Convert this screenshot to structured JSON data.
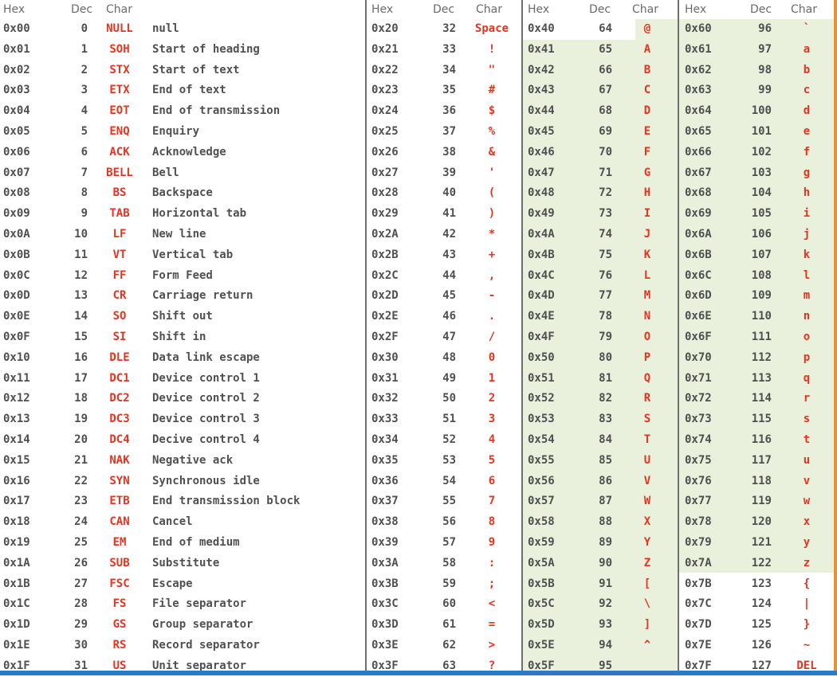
{
  "headers": {
    "g1": [
      "Hex",
      "Dec",
      "Char"
    ],
    "g2": [
      "Hex",
      "Dec",
      "Char"
    ],
    "g3": [
      "Hex",
      "Dec",
      "Char"
    ],
    "g4": [
      "Hex",
      "Dec",
      "Char"
    ]
  },
  "control_rows": [
    [
      "0x00",
      "0",
      "NULL",
      "null"
    ],
    [
      "0x01",
      "1",
      "SOH",
      "Start of heading"
    ],
    [
      "0x02",
      "2",
      "STX",
      "Start of text"
    ],
    [
      "0x03",
      "3",
      "ETX",
      "End of text"
    ],
    [
      "0x04",
      "4",
      "EOT",
      "End of transmission"
    ],
    [
      "0x05",
      "5",
      "ENQ",
      "Enquiry"
    ],
    [
      "0x06",
      "6",
      "ACK",
      "Acknowledge"
    ],
    [
      "0x07",
      "7",
      "BELL",
      "Bell"
    ],
    [
      "0x08",
      "8",
      "BS",
      "Backspace"
    ],
    [
      "0x09",
      "9",
      "TAB",
      "Horizontal tab"
    ],
    [
      "0x0A",
      "10",
      "LF",
      "New line"
    ],
    [
      "0x0B",
      "11",
      "VT",
      "Vertical tab"
    ],
    [
      "0x0C",
      "12",
      "FF",
      "Form Feed"
    ],
    [
      "0x0D",
      "13",
      "CR",
      "Carriage return"
    ],
    [
      "0x0E",
      "14",
      "SO",
      "Shift out"
    ],
    [
      "0x0F",
      "15",
      "SI",
      "Shift in"
    ],
    [
      "0x10",
      "16",
      "DLE",
      "Data link escape"
    ],
    [
      "0x11",
      "17",
      "DC1",
      "Device control 1"
    ],
    [
      "0x12",
      "18",
      "DC2",
      "Device control 2"
    ],
    [
      "0x13",
      "19",
      "DC3",
      "Device control 3"
    ],
    [
      "0x14",
      "20",
      "DC4",
      "Decive control 4"
    ],
    [
      "0x15",
      "21",
      "NAK",
      "Negative ack"
    ],
    [
      "0x16",
      "22",
      "SYN",
      "Synchronous idle"
    ],
    [
      "0x17",
      "23",
      "ETB",
      "End transmission block"
    ],
    [
      "0x18",
      "24",
      "CAN",
      "Cancel"
    ],
    [
      "0x19",
      "25",
      "EM",
      "End of medium"
    ],
    [
      "0x1A",
      "26",
      "SUB",
      "Substitute"
    ],
    [
      "0x1B",
      "27",
      "FSC",
      "Escape"
    ],
    [
      "0x1C",
      "28",
      "FS",
      "File separator"
    ],
    [
      "0x1D",
      "29",
      "GS",
      "Group separator"
    ],
    [
      "0x1E",
      "30",
      "RS",
      "Record separator"
    ],
    [
      "0x1F",
      "31",
      "US",
      "Unit separator"
    ]
  ],
  "punct_rows": [
    [
      "0x20",
      "32",
      "Space"
    ],
    [
      "0x21",
      "33",
      "!"
    ],
    [
      "0x22",
      "34",
      "\""
    ],
    [
      "0x23",
      "35",
      "#"
    ],
    [
      "0x24",
      "36",
      "$"
    ],
    [
      "0x25",
      "37",
      "%"
    ],
    [
      "0x26",
      "38",
      "&"
    ],
    [
      "0x27",
      "39",
      "'"
    ],
    [
      "0x28",
      "40",
      "("
    ],
    [
      "0x29",
      "41",
      ")"
    ],
    [
      "0x2A",
      "42",
      "*"
    ],
    [
      "0x2B",
      "43",
      "+"
    ],
    [
      "0x2C",
      "44",
      ","
    ],
    [
      "0x2D",
      "45",
      "-"
    ],
    [
      "0x2E",
      "46",
      "."
    ],
    [
      "0x2F",
      "47",
      "/"
    ],
    [
      "0x30",
      "48",
      "0"
    ],
    [
      "0x31",
      "49",
      "1"
    ],
    [
      "0x32",
      "50",
      "2"
    ],
    [
      "0x33",
      "51",
      "3"
    ],
    [
      "0x34",
      "52",
      "4"
    ],
    [
      "0x35",
      "53",
      "5"
    ],
    [
      "0x36",
      "54",
      "6"
    ],
    [
      "0x37",
      "55",
      "7"
    ],
    [
      "0x38",
      "56",
      "8"
    ],
    [
      "0x39",
      "57",
      "9"
    ],
    [
      "0x3A",
      "58",
      ":"
    ],
    [
      "0x3B",
      "59",
      ";"
    ],
    [
      "0x3C",
      "60",
      "<"
    ],
    [
      "0x3D",
      "61",
      "="
    ],
    [
      "0x3E",
      "62",
      ">"
    ],
    [
      "0x3F",
      "63",
      "?"
    ]
  ],
  "upper_rows": [
    [
      "0x40",
      "64",
      "@"
    ],
    [
      "0x41",
      "65",
      "A"
    ],
    [
      "0x42",
      "66",
      "B"
    ],
    [
      "0x43",
      "67",
      "C"
    ],
    [
      "0x44",
      "68",
      "D"
    ],
    [
      "0x45",
      "69",
      "E"
    ],
    [
      "0x46",
      "70",
      "F"
    ],
    [
      "0x47",
      "71",
      "G"
    ],
    [
      "0x48",
      "72",
      "H"
    ],
    [
      "0x49",
      "73",
      "I"
    ],
    [
      "0x4A",
      "74",
      "J"
    ],
    [
      "0x4B",
      "75",
      "K"
    ],
    [
      "0x4C",
      "76",
      "L"
    ],
    [
      "0x4D",
      "77",
      "M"
    ],
    [
      "0x4E",
      "78",
      "N"
    ],
    [
      "0x4F",
      "79",
      "O"
    ],
    [
      "0x50",
      "80",
      "P"
    ],
    [
      "0x51",
      "81",
      "Q"
    ],
    [
      "0x52",
      "82",
      "R"
    ],
    [
      "0x53",
      "83",
      "S"
    ],
    [
      "0x54",
      "84",
      "T"
    ],
    [
      "0x55",
      "85",
      "U"
    ],
    [
      "0x56",
      "86",
      "V"
    ],
    [
      "0x57",
      "87",
      "W"
    ],
    [
      "0x58",
      "88",
      "X"
    ],
    [
      "0x59",
      "89",
      "Y"
    ],
    [
      "0x5A",
      "90",
      "Z"
    ],
    [
      "0x5B",
      "91",
      "["
    ],
    [
      "0x5C",
      "92",
      "\\"
    ],
    [
      "0x5D",
      "93",
      "]"
    ],
    [
      "0x5E",
      "94",
      "^"
    ],
    [
      "0x5F",
      "95",
      "_"
    ]
  ],
  "lower_rows": [
    [
      "0x60",
      "96",
      "`"
    ],
    [
      "0x61",
      "97",
      "a"
    ],
    [
      "0x62",
      "98",
      "b"
    ],
    [
      "0x63",
      "99",
      "c"
    ],
    [
      "0x64",
      "100",
      "d"
    ],
    [
      "0x65",
      "101",
      "e"
    ],
    [
      "0x66",
      "102",
      "f"
    ],
    [
      "0x67",
      "103",
      "g"
    ],
    [
      "0x68",
      "104",
      "h"
    ],
    [
      "0x69",
      "105",
      "i"
    ],
    [
      "0x6A",
      "106",
      "j"
    ],
    [
      "0x6B",
      "107",
      "k"
    ],
    [
      "0x6C",
      "108",
      "l"
    ],
    [
      "0x6D",
      "109",
      "m"
    ],
    [
      "0x6E",
      "110",
      "n"
    ],
    [
      "0x6F",
      "111",
      "o"
    ],
    [
      "0x70",
      "112",
      "p"
    ],
    [
      "0x71",
      "113",
      "q"
    ],
    [
      "0x72",
      "114",
      "r"
    ],
    [
      "0x73",
      "115",
      "s"
    ],
    [
      "0x74",
      "116",
      "t"
    ],
    [
      "0x75",
      "117",
      "u"
    ],
    [
      "0x76",
      "118",
      "v"
    ],
    [
      "0x77",
      "119",
      "w"
    ],
    [
      "0x78",
      "120",
      "x"
    ],
    [
      "0x79",
      "121",
      "y"
    ],
    [
      "0x7A",
      "122",
      "z"
    ],
    [
      "0x7B",
      "123",
      "{"
    ],
    [
      "0x7C",
      "124",
      "|"
    ],
    [
      "0x7D",
      "125",
      "}"
    ],
    [
      "0x7E",
      "126",
      "~"
    ],
    [
      "0x7F",
      "127",
      "DEL"
    ]
  ],
  "colors": {
    "accent_red": "#e8331f",
    "text_gray": "#505050",
    "letter_bg": "#e9f0dc",
    "bottom_bar": "#2c79c5",
    "right_bar": "#f0901f"
  }
}
